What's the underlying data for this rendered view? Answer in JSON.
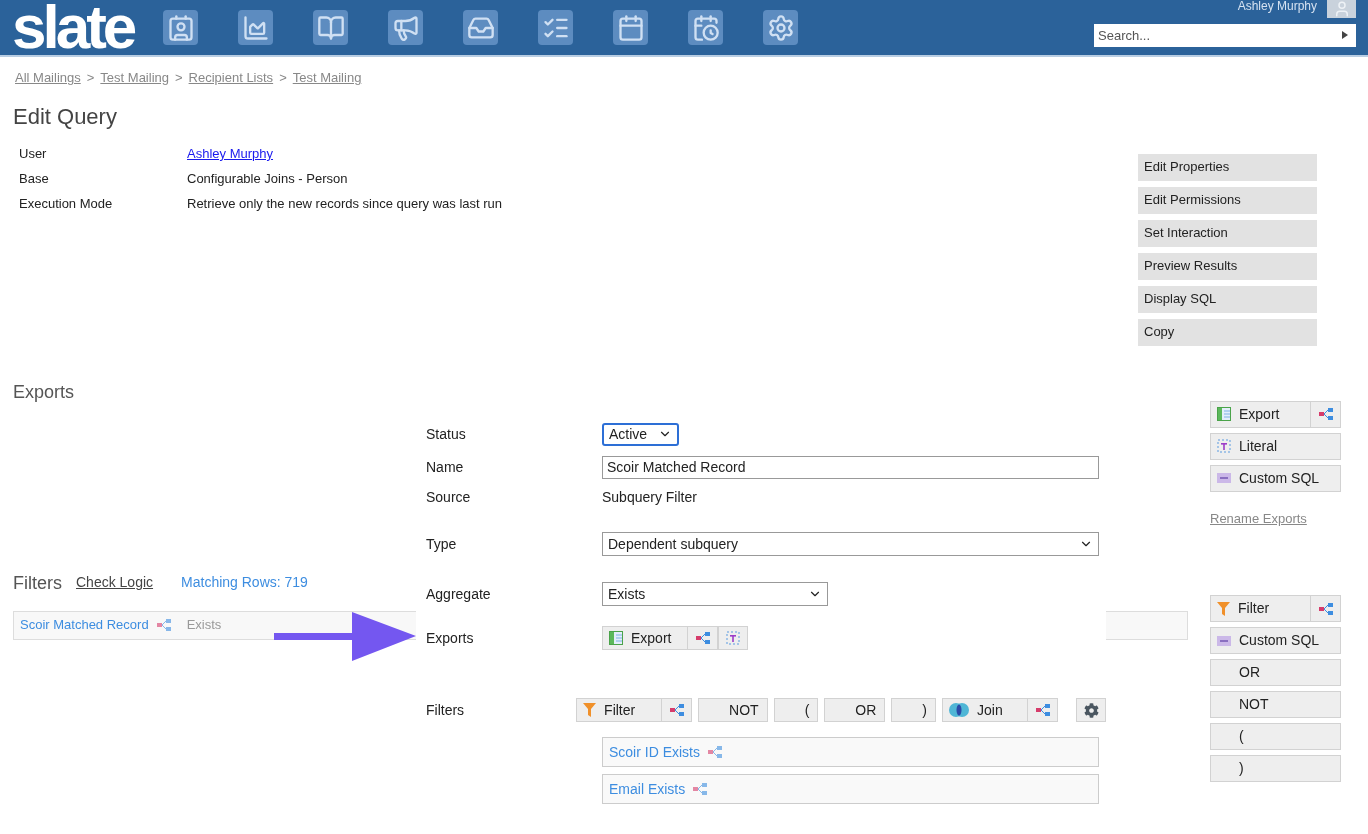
{
  "header": {
    "logo": "slate",
    "user": "Ashley Murphy",
    "search": {
      "placeholder": "Search..."
    }
  },
  "breadcrumbs": [
    {
      "kind": "link",
      "text": "All Mailings"
    },
    {
      "kind": "separator",
      "text": ">"
    },
    {
      "kind": "link",
      "text": "Test Mailing"
    },
    {
      "kind": "separator",
      "text": ">"
    },
    {
      "kind": "link",
      "text": "Recipient Lists"
    },
    {
      "kind": "separator",
      "text": ">"
    },
    {
      "kind": "link",
      "text": "Test Mailing"
    }
  ],
  "title": "Edit Query",
  "properties": [
    {
      "label": "User",
      "value": "Ashley Murphy",
      "kind": "link"
    },
    {
      "label": "Base",
      "value": "Configurable Joins - Person",
      "kind": "text"
    },
    {
      "label": "Execution Mode",
      "value": "Retrieve only the new records since query was last run",
      "kind": "text"
    }
  ],
  "actions": [
    "Edit Properties",
    "Edit Permissions",
    "Set Interaction",
    "Preview Results",
    "Display SQL",
    "Copy"
  ],
  "exports": {
    "heading": "Exports",
    "buttons": [
      {
        "kind": "export",
        "label": "Export",
        "split": true
      },
      {
        "kind": "literal",
        "label": "Literal",
        "split": false
      },
      {
        "kind": "sql",
        "label": "Custom SQL",
        "split": false
      }
    ],
    "rename_link": "Rename Exports"
  },
  "filters": {
    "heading": "Filters",
    "check_logic": "Check Logic",
    "matching_rows": "Matching Rows: 719",
    "rows": [
      {
        "name": "Scoir Matched Record",
        "operator": "Exists"
      }
    ],
    "buttons": [
      {
        "kind": "filter",
        "label": "Filter",
        "split": true
      },
      {
        "kind": "sql",
        "label": "Custom SQL",
        "split": false
      },
      {
        "kind": "none",
        "label": "OR",
        "split": false
      },
      {
        "kind": "none",
        "label": "NOT",
        "split": false
      },
      {
        "kind": "none",
        "label": "(",
        "split": false
      },
      {
        "kind": "none",
        "label": ")",
        "split": false
      }
    ]
  },
  "editor": {
    "status": {
      "label": "Status",
      "value": "Active"
    },
    "name": {
      "label": "Name",
      "value": "Scoir Matched Record"
    },
    "source": {
      "label": "Source",
      "value": "Subquery Filter"
    },
    "type": {
      "label": "Type",
      "value": "Dependent subquery"
    },
    "aggregate": {
      "label": "Aggregate",
      "value": "Exists"
    },
    "exports": {
      "label": "Exports",
      "toolbar": [
        {
          "kind": "export",
          "label": "Export",
          "split": true
        },
        {
          "kind": "literal",
          "split": false
        }
      ]
    },
    "filters": {
      "label": "Filters",
      "toolbar": [
        {
          "kind": "filter",
          "label": "Filter",
          "split": true
        },
        {
          "kind": "none",
          "label": "NOT",
          "split": false
        },
        {
          "kind": "none",
          "label": "(",
          "split": false
        },
        {
          "kind": "none",
          "label": "OR",
          "split": false
        },
        {
          "kind": "none",
          "label": ")",
          "split": false
        },
        {
          "kind": "join",
          "label": "Join",
          "split": true
        },
        {
          "kind": "settings",
          "split": false
        }
      ],
      "items": [
        "Scoir ID Exists",
        "Email Exists"
      ]
    }
  }
}
